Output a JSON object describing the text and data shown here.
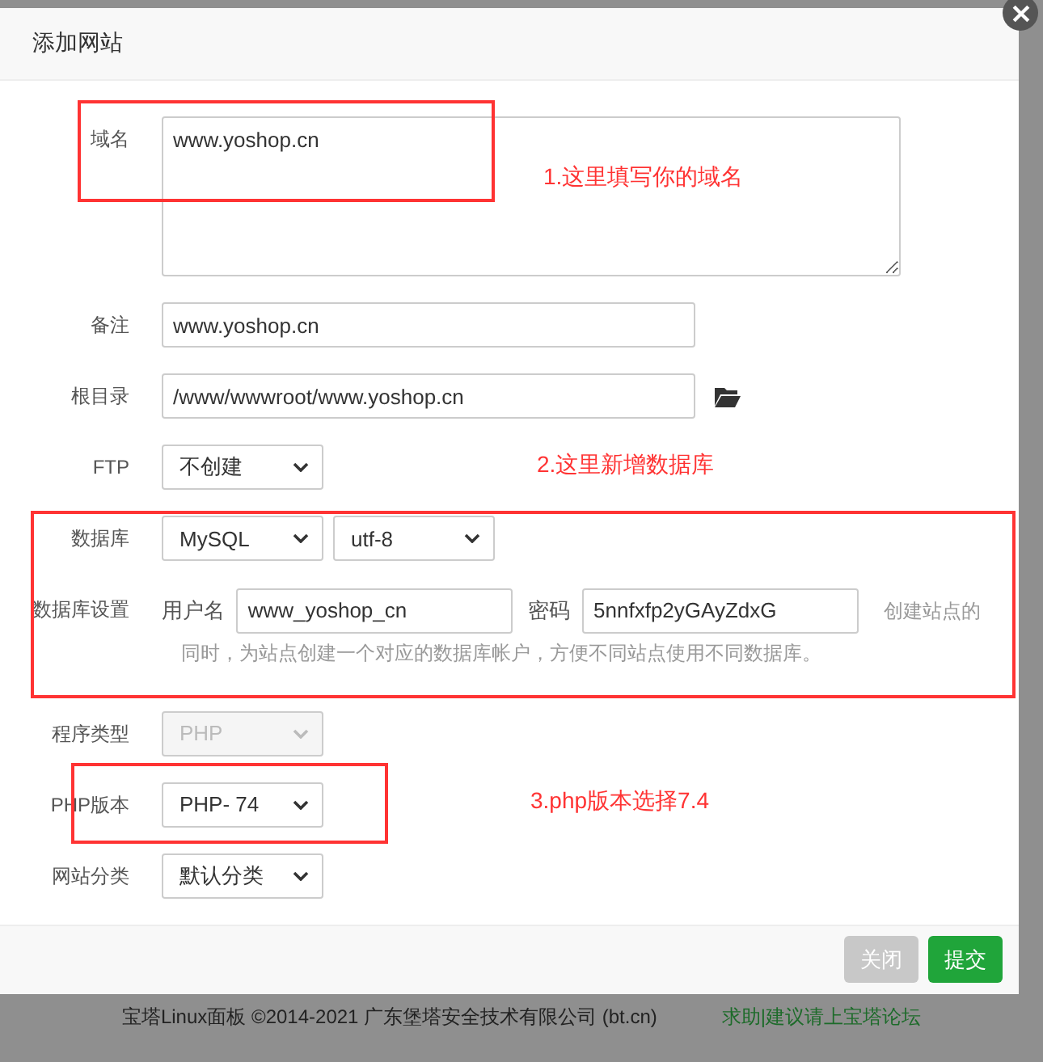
{
  "dialog": {
    "title": "添加网站",
    "fields": [
      {
        "kind": "textarea",
        "label": "域名",
        "value": "www.yoshop.cn"
      },
      {
        "kind": "text",
        "label": "备注",
        "value": "www.yoshop.cn"
      },
      {
        "kind": "path",
        "label": "根目录",
        "value": "/www/wwwroot/www.yoshop.cn"
      },
      {
        "kind": "select",
        "label": "FTP",
        "value": "不创建",
        "disabled": false
      },
      {
        "kind": "database",
        "label": "数据库",
        "selects": [
          "MySQL",
          "utf-8"
        ]
      },
      {
        "kind": "credentials",
        "label": "数据库设置",
        "username_label": "用户名",
        "username": "www_yoshop_cn",
        "password_label": "密码",
        "password": "5nnfxfp2yGAyZdxG",
        "hint_lines": [
          "创建站点的",
          "同时，为站点创建一个对应的数据库帐户，方便不同站点使用不同数据库。"
        ]
      },
      {
        "kind": "select",
        "label": "程序类型",
        "value": "PHP",
        "disabled": true
      },
      {
        "kind": "select",
        "label": "PHP版本",
        "value": "PHP- 74",
        "disabled": false
      },
      {
        "kind": "select",
        "label": "网站分类",
        "value": "默认分类",
        "disabled": false
      }
    ],
    "buttons": [
      {
        "label": "关闭",
        "kind": "secondary"
      },
      {
        "label": "提交",
        "kind": "primary"
      }
    ]
  },
  "annotations": [
    {
      "text": "1.这里填写你的域名"
    },
    {
      "text": "2.这里新增数据库"
    },
    {
      "text": "3.php版本选择7.4"
    }
  ],
  "page_footer": {
    "copyright": "宝塔Linux面板 ©2014-2021 广东堡塔安全技术有限公司 (bt.cn)",
    "link": "求助|建议请上宝塔论坛"
  }
}
